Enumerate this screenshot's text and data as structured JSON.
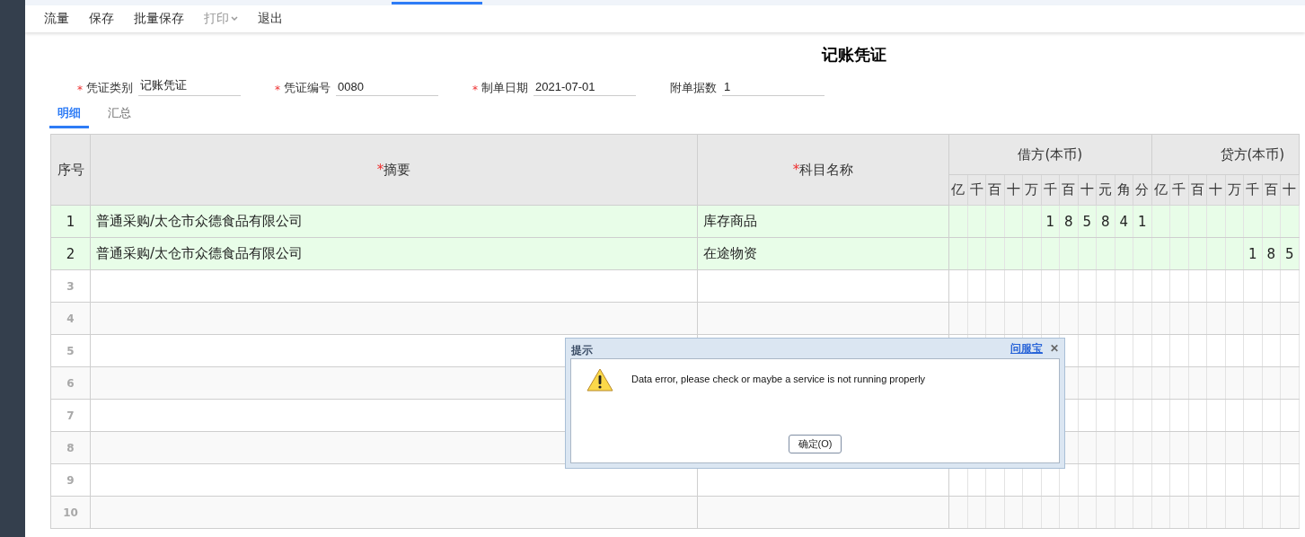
{
  "toolbar": [
    {
      "label": "流量",
      "disabled": false
    },
    {
      "label": "保存",
      "disabled": false
    },
    {
      "label": "批量保存",
      "disabled": false
    },
    {
      "label": "打印",
      "disabled": true,
      "kind": "menu"
    },
    {
      "label": "退出",
      "disabled": false
    }
  ],
  "title": "记账凭证",
  "fields": [
    {
      "mark": "*",
      "label": "凭证类别",
      "value": "记账凭证"
    },
    {
      "mark": "*",
      "label": "凭证编号",
      "value": "0080"
    },
    {
      "mark": "*",
      "label": "制单日期",
      "value": "2021-07-01"
    },
    {
      "label": "附单据数",
      "value": "1"
    }
  ],
  "tabs": [
    {
      "label": "明细",
      "selected": true
    },
    {
      "label": "汇总",
      "selected": false
    }
  ],
  "table": {
    "columns": [
      {
        "label": "序号"
      },
      {
        "mark": "*",
        "label": "摘要"
      },
      {
        "mark": "*",
        "label": "科目名称"
      }
    ],
    "debit_header": "借方(本币)",
    "credit_header": "贷方(本币)",
    "debit_units": [
      "亿",
      "千",
      "百",
      "十",
      "万",
      "千",
      "百",
      "十",
      "元",
      "角",
      "分"
    ],
    "credit_units": [
      "亿",
      "千",
      "百",
      "十",
      "万",
      "千",
      "百",
      "十"
    ],
    "rows": [
      {
        "no": "1",
        "summary": "普通采购/太仓市众德食品有限公司",
        "account": "库存商品",
        "debit_digits": [
          "1",
          "8",
          "5",
          "8",
          "4",
          "1"
        ],
        "filled": true
      },
      {
        "no": "2",
        "summary": "普通采购/太仓市众德食品有限公司",
        "account": "在途物资",
        "credit_digits": [
          "1",
          "8",
          "5"
        ],
        "filled": true
      },
      {
        "no": "3",
        "filled": false
      },
      {
        "no": "4",
        "filled": false
      },
      {
        "no": "5",
        "filled": false
      },
      {
        "no": "6",
        "filled": false
      },
      {
        "no": "7",
        "filled": false
      },
      {
        "no": "8",
        "filled": false
      },
      {
        "no": "9",
        "filled": false
      },
      {
        "no": "10",
        "filled": false
      }
    ]
  },
  "dialog": {
    "title": "提示",
    "link": "问服宝",
    "close": "✕",
    "message": "Data error, please check or maybe a service is not running properly",
    "button": "确定(O)"
  }
}
